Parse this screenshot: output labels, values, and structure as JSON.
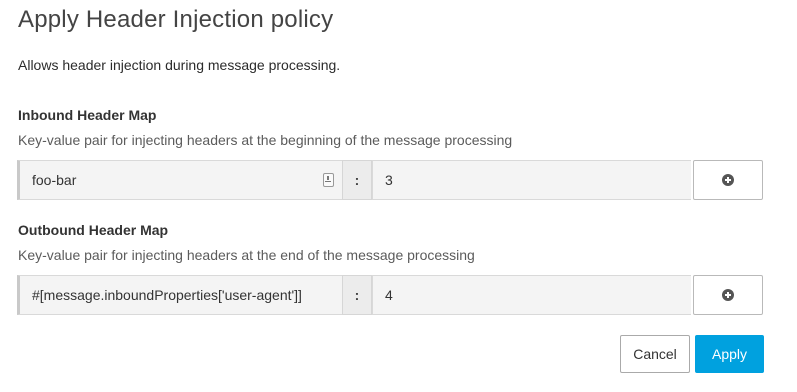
{
  "dialog": {
    "title": "Apply Header Injection policy",
    "description": "Allows header injection during message processing."
  },
  "inbound": {
    "title": "Inbound Header Map",
    "help": "Key-value pair for injecting headers at the beginning of the message processing",
    "key_value": "foo-bar",
    "separator": ":",
    "value": "3",
    "add_icon": "plus-circle-icon"
  },
  "outbound": {
    "title": "Outbound Header Map",
    "help": "Key-value pair for injecting headers at the end of the message processing",
    "key_value": "#[message.inboundProperties['user-agent']]",
    "separator": ":",
    "value": "4",
    "add_icon": "plus-circle-icon"
  },
  "actions": {
    "cancel_label": "Cancel",
    "apply_label": "Apply"
  },
  "colors": {
    "accent": "#00a1df"
  }
}
